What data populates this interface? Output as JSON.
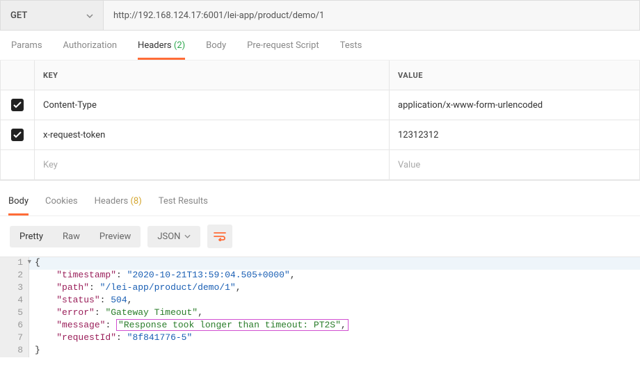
{
  "request": {
    "method": "GET",
    "url": "http://192.168.124.17:6001/lei-app/product/demo/1"
  },
  "request_tabs": [
    {
      "label": "Params",
      "active": false
    },
    {
      "label": "Authorization",
      "active": false
    },
    {
      "label": "Headers",
      "count": "(2)",
      "active": true
    },
    {
      "label": "Body",
      "active": false
    },
    {
      "label": "Pre-request Script",
      "active": false
    },
    {
      "label": "Tests",
      "active": false
    }
  ],
  "headers_table": {
    "head_key": "KEY",
    "head_value": "VALUE",
    "rows": [
      {
        "checked": true,
        "key": "Content-Type",
        "value": "application/x-www-form-urlencoded"
      },
      {
        "checked": true,
        "key": "x-request-token",
        "value": "12312312"
      }
    ],
    "placeholder_key": "Key",
    "placeholder_value": "Value"
  },
  "response_tabs": [
    {
      "label": "Body",
      "active": true
    },
    {
      "label": "Cookies",
      "active": false
    },
    {
      "label": "Headers",
      "count": "(8)",
      "active": false
    },
    {
      "label": "Test Results",
      "active": false
    }
  ],
  "toolbar": {
    "pretty": "Pretty",
    "raw": "Raw",
    "preview": "Preview",
    "format": "JSON"
  },
  "json": {
    "timestamp": "2020-10-21T13:59:04.505+0000",
    "path": "/lei-app/product/demo/1",
    "status": 504,
    "error": "Gateway Timeout",
    "message": "Response took longer than timeout: PT2S",
    "requestId": "8f841776-5"
  },
  "code_lines": [
    "1",
    "2",
    "3",
    "4",
    "5",
    "6",
    "7",
    "8"
  ]
}
